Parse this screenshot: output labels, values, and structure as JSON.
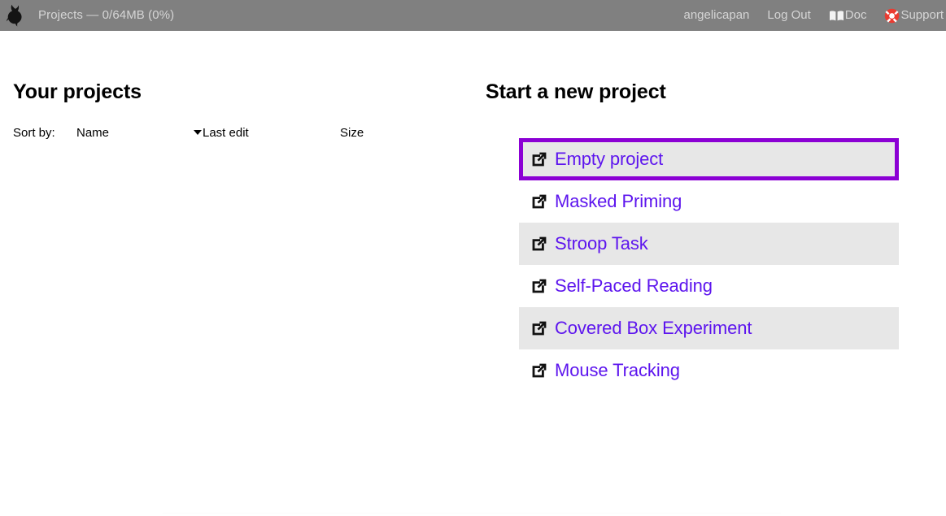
{
  "topbar": {
    "logo_icon": "goat-head-logo",
    "title": "Projects  —  0/64MB (0%)",
    "background_color": "#808080",
    "text_color": "#d5d5d5",
    "right_items": [
      {
        "label": "angelicapan",
        "icon": null
      },
      {
        "label": "Log Out",
        "icon": null
      },
      {
        "label": "Doc",
        "icon": "open-book-icon"
      },
      {
        "label": "Support",
        "icon": "lifebuoy-icon"
      }
    ]
  },
  "projects_panel": {
    "title": "Your projects",
    "sort": {
      "label": "Sort by:",
      "options": [
        {
          "label": "Name",
          "active": false,
          "caret": false
        },
        {
          "label": "Last edit",
          "active": true,
          "caret": true
        },
        {
          "label": "Size",
          "active": false,
          "caret": false
        }
      ]
    },
    "rows": []
  },
  "new_project_panel": {
    "title": "Start a new project",
    "link_color": "#5d15ee",
    "focus_ring_color": "#8b00d4",
    "zebra_color": "#e7e7e7",
    "items": [
      {
        "label": "Empty project",
        "icon": "external-link-icon",
        "focused": true,
        "zebra": true
      },
      {
        "label": "Masked Priming",
        "icon": "external-link-icon",
        "focused": false,
        "zebra": false
      },
      {
        "label": "Stroop Task",
        "icon": "external-link-icon",
        "focused": false,
        "zebra": true
      },
      {
        "label": "Self-Paced Reading",
        "icon": "external-link-icon",
        "focused": false,
        "zebra": false
      },
      {
        "label": "Covered Box Experiment",
        "icon": "external-link-icon",
        "focused": false,
        "zebra": true
      },
      {
        "label": "Mouse Tracking",
        "icon": "external-link-icon",
        "focused": false,
        "zebra": false
      }
    ]
  }
}
